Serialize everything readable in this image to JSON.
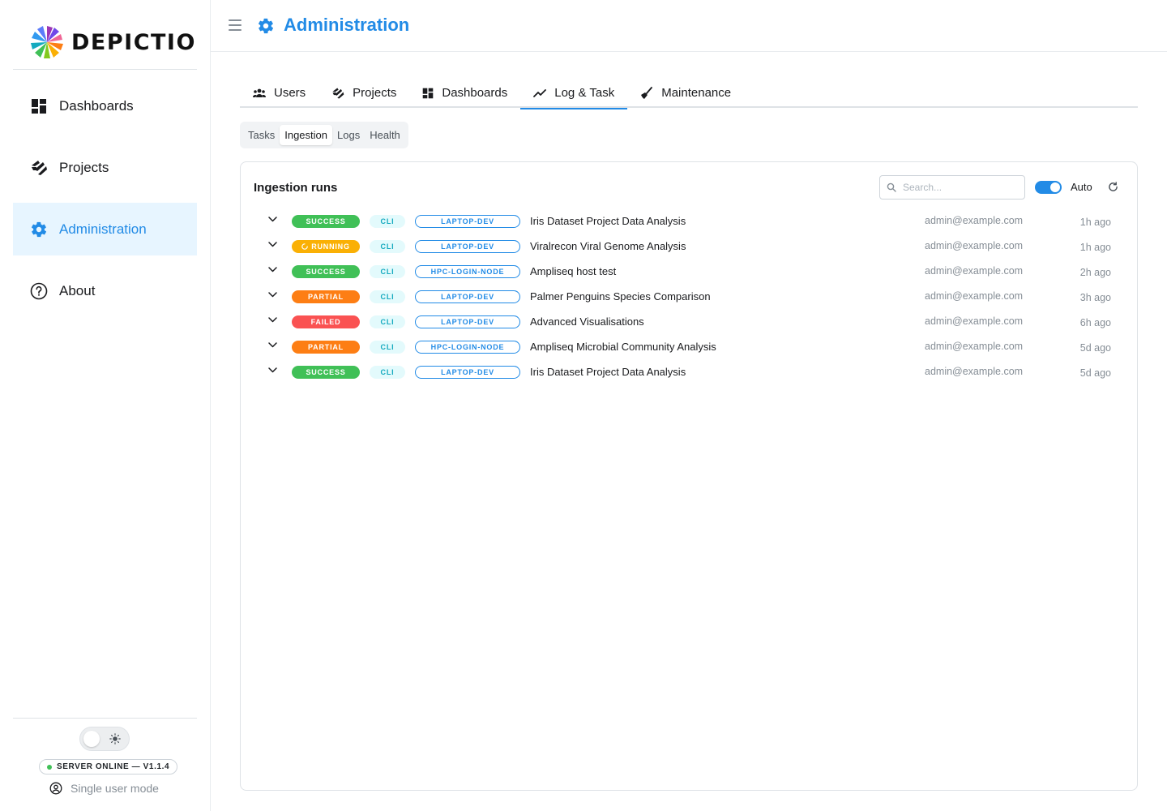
{
  "brand": {
    "name": "DEPICTIO"
  },
  "sidebar": {
    "items": [
      {
        "label": "Dashboards",
        "icon": "dashboard-icon",
        "active": false
      },
      {
        "label": "Projects",
        "icon": "projects-icon",
        "active": false
      },
      {
        "label": "Administration",
        "icon": "gear-icon",
        "active": true
      },
      {
        "label": "About",
        "icon": "help-circle-icon",
        "active": false
      }
    ],
    "server_status": "SERVER ONLINE — V1.1.4",
    "user_mode": "Single user mode"
  },
  "header": {
    "title": "Administration"
  },
  "tabs": [
    {
      "label": "Users",
      "icon": "users-icon"
    },
    {
      "label": "Projects",
      "icon": "projects-icon"
    },
    {
      "label": "Dashboards",
      "icon": "dashboard-icon"
    },
    {
      "label": "Log & Task",
      "icon": "chart-line-icon",
      "active": true
    },
    {
      "label": "Maintenance",
      "icon": "broom-icon"
    }
  ],
  "subtabs": [
    {
      "label": "Tasks"
    },
    {
      "label": "Ingestion",
      "active": true
    },
    {
      "label": "Logs"
    },
    {
      "label": "Health"
    }
  ],
  "card": {
    "title": "Ingestion runs",
    "search_placeholder": "Search...",
    "auto_label": "Auto",
    "auto_enabled": true
  },
  "colors": {
    "success": "#40c057",
    "running": "#fab005",
    "partial": "#fd7e14",
    "failed": "#fa5252",
    "accent": "#228be6"
  },
  "runs": [
    {
      "status": "SUCCESS",
      "source": "CLI",
      "host": "LAPTOP-DEV",
      "name": "Iris Dataset Project Data Analysis",
      "user": "admin@example.com",
      "time": "1h ago"
    },
    {
      "status": "RUNNING",
      "source": "CLI",
      "host": "LAPTOP-DEV",
      "name": "Viralrecon Viral Genome Analysis",
      "user": "admin@example.com",
      "time": "1h ago"
    },
    {
      "status": "SUCCESS",
      "source": "CLI",
      "host": "HPC-LOGIN-NODE",
      "name": "Ampliseq host test",
      "user": "admin@example.com",
      "time": "2h ago"
    },
    {
      "status": "PARTIAL",
      "source": "CLI",
      "host": "LAPTOP-DEV",
      "name": "Palmer Penguins Species Comparison",
      "user": "admin@example.com",
      "time": "3h ago"
    },
    {
      "status": "FAILED",
      "source": "CLI",
      "host": "LAPTOP-DEV",
      "name": "Advanced Visualisations",
      "user": "admin@example.com",
      "time": "6h ago"
    },
    {
      "status": "PARTIAL",
      "source": "CLI",
      "host": "HPC-LOGIN-NODE",
      "name": "Ampliseq Microbial Community Analysis",
      "user": "admin@example.com",
      "time": "5d ago"
    },
    {
      "status": "SUCCESS",
      "source": "CLI",
      "host": "LAPTOP-DEV",
      "name": "Iris Dataset Project Data Analysis",
      "user": "admin@example.com",
      "time": "5d ago"
    }
  ]
}
